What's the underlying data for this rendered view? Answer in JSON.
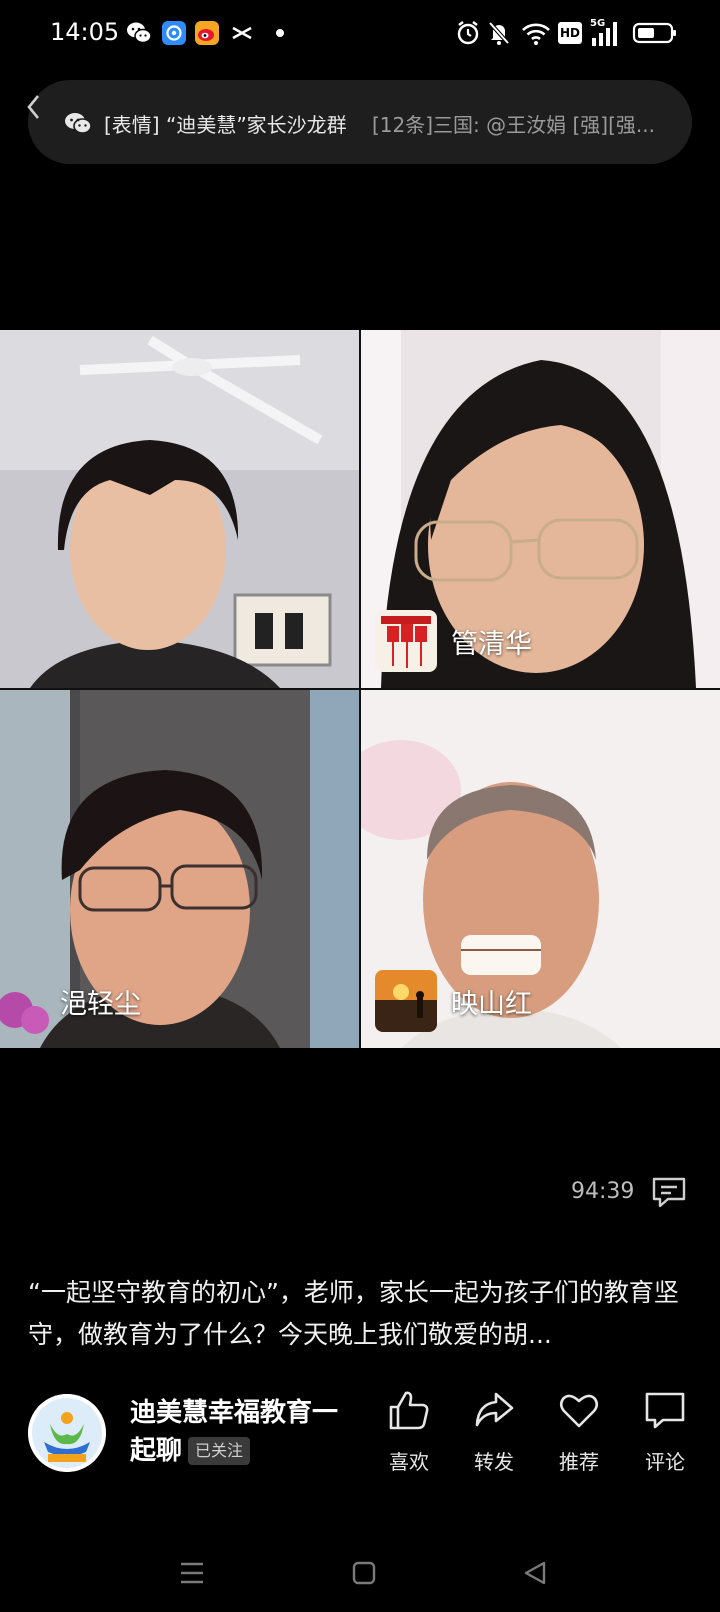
{
  "status_bar": {
    "time": "14:05",
    "left_icons": [
      "wechat-icon",
      "app-icon",
      "weibo-icon",
      "capcut-icon"
    ],
    "right_icons": [
      "alarm-icon",
      "mute-icon",
      "wifi-icon",
      "hd-icon",
      "5g-signal-icon",
      "battery-icon"
    ],
    "hd_label": "HD",
    "network_label": "5G"
  },
  "notification": {
    "title": "[表情] “迪美慧”家长沙龙群",
    "preview": "[12条]三国: @王汝娟 [强][强..."
  },
  "video_grid": {
    "participants": [
      {
        "name": ""
      },
      {
        "name": "管清华"
      },
      {
        "name": "浥轻尘"
      },
      {
        "name": "映山红"
      }
    ]
  },
  "player": {
    "duration": "94:39"
  },
  "description": "“一起坚守教育的初心”，老师，家长一起为孩子们的教育坚守，做教育为了什么？今天晚上我们敬爱的胡...",
  "author": {
    "name": "迪美慧幸福教育一起聊",
    "follow_status": "已关注"
  },
  "actions": [
    {
      "label": "喜欢",
      "icon": "thumbs-up-icon"
    },
    {
      "label": "转发",
      "icon": "share-icon"
    },
    {
      "label": "推荐",
      "icon": "heart-icon"
    },
    {
      "label": "评论",
      "icon": "comment-icon"
    }
  ],
  "nav_bar": [
    "menu-icon",
    "home-icon",
    "back-icon"
  ]
}
